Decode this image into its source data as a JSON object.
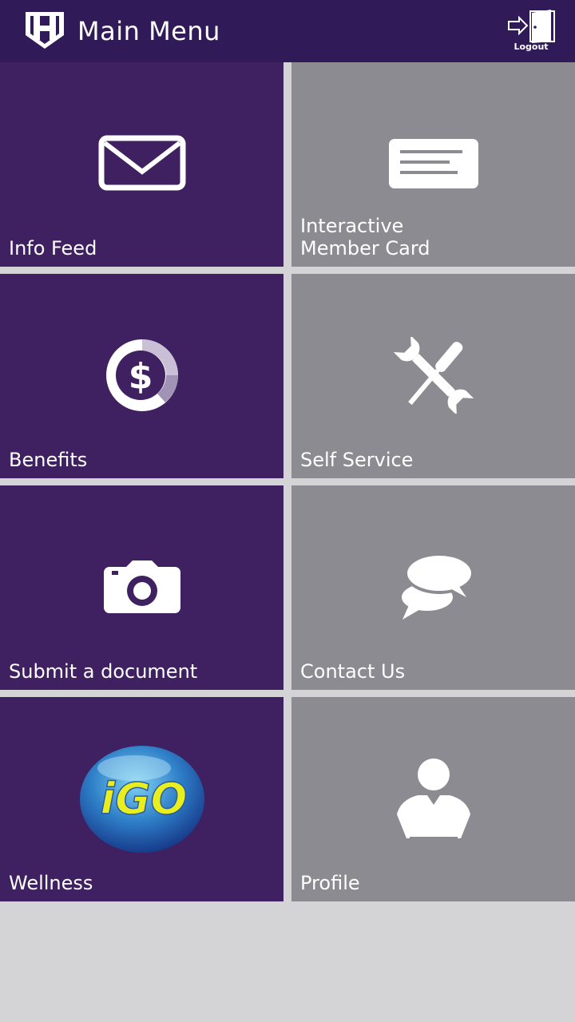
{
  "header": {
    "title": "Main Menu",
    "logout_label": "Logout",
    "logo_icon": "shield-h-logo",
    "background": "#301b58"
  },
  "menu": {
    "tiles": [
      {
        "label": "Info Feed",
        "icon": "envelope-icon",
        "color": "#3f2161"
      },
      {
        "label": "Interactive\nMember Card",
        "icon": "card-icon",
        "color": "#8c8b91"
      },
      {
        "label": "Benefits",
        "icon": "dollar-circle-icon",
        "color": "#3f2161"
      },
      {
        "label": "Self Service",
        "icon": "tools-icon",
        "color": "#8c8b91"
      },
      {
        "label": "Submit a document",
        "icon": "camera-icon",
        "color": "#3f2161"
      },
      {
        "label": "Contact Us",
        "icon": "chat-bubbles-icon",
        "color": "#8c8b91"
      },
      {
        "label": "Wellness",
        "icon": "igo-logo",
        "logo_text": "iGO",
        "color": "#3f2161"
      },
      {
        "label": "Profile",
        "icon": "person-icon",
        "color": "#8c8b91"
      }
    ]
  },
  "colors": {
    "page_background": "#d4d4d6",
    "purple_tile": "#3f2161",
    "gray_tile": "#8c8b91"
  }
}
